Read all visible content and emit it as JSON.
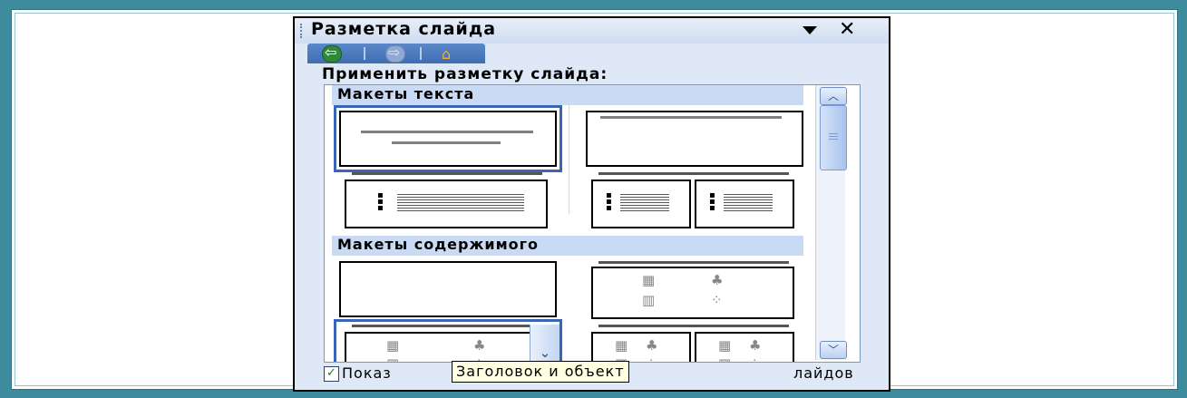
{
  "pane": {
    "title": "Разметка слайда",
    "apply_label": "Применить разметку слайда:",
    "nav": {
      "back_icon": "back-arrow-icon",
      "forward_icon": "forward-arrow-icon",
      "home_icon": "home-icon"
    }
  },
  "gallery": {
    "sections": [
      {
        "label": "Макеты текста"
      },
      {
        "label": "Макеты содержимого"
      }
    ]
  },
  "footer": {
    "checkbox_checked": true,
    "checkbox_label_visible": "Показ",
    "checkbox_label_tail": "лайдов"
  },
  "tooltip": {
    "text": "Заголовок и объект"
  },
  "colors": {
    "frame": "#3d8b9c",
    "pane_bg": "#dfe8f6",
    "selection": "#3a64b6",
    "section_bg": "#c9dbf4"
  }
}
